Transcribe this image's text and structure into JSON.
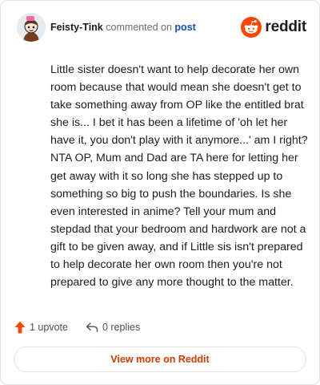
{
  "comment": {
    "author": "Feisty-Tink",
    "action_text": "commented on",
    "post_link": "post",
    "body": "Little sister doesn't want to help decorate her own room because that would mean she doesn't get to take something away from OP like the entitled brat she is... I bet it has been a lifetime of 'oh let her have it, you don't play with it anymore...' am I right? NTA OP, Mum and Dad are TA here for letting her get away with it so long she has stepped up to something so big to push the boundaries. Is she even interested in anime? Tell your mum and stepdad that your bedroom and hardwork are not a gift to be given away, and if Little sis isn't prepared to help decorate her own room then you're not prepared to give any more thought to the matter."
  },
  "brand": {
    "wordmark": "reddit",
    "icon": "reddit-alien-logo"
  },
  "actions": {
    "upvote_label": "1 upvote",
    "replies_label": "0 replies",
    "upvote_icon": "upvote-arrow-icon",
    "reply_icon": "reply-arrow-icon"
  },
  "cta": {
    "label": "View more on Reddit"
  },
  "colors": {
    "accent": "#ff4500",
    "cta_text": "#d93a00",
    "link": "#0e4fb8",
    "border": "#dfe1e4"
  }
}
